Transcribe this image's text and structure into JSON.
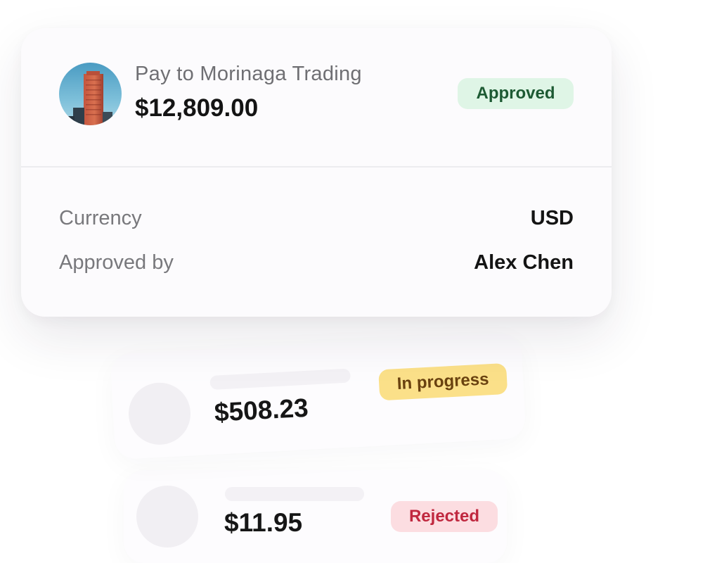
{
  "payment": {
    "payee_text": "Pay to Morinaga Trading",
    "amount": "$12,809.00",
    "status": "Approved",
    "status_color": "#1d5a33",
    "status_bg": "#dff5e6",
    "avatar_icon": "building-photo-avatar",
    "details": [
      {
        "label": "Currency",
        "value": "USD"
      },
      {
        "label": "Approved by",
        "value": "Alex Chen"
      }
    ]
  },
  "background_payments": [
    {
      "amount": "$508.23",
      "status": "In progress",
      "status_color": "#6a4210",
      "status_bg": "#fbe089"
    },
    {
      "amount": "$11.95",
      "status": "Rejected",
      "status_color": "#c0283f",
      "status_bg": "#fcdde1"
    }
  ]
}
